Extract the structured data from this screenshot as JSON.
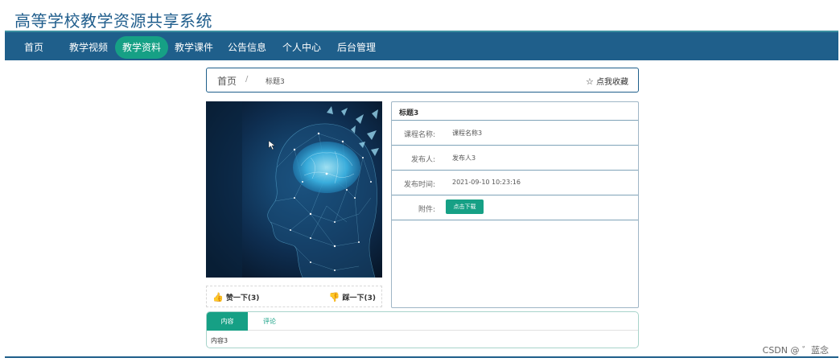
{
  "site": {
    "title": "高等学校教学资源共享系统"
  },
  "nav": {
    "items": [
      "首页",
      "教学视频",
      "教学资料",
      "教学课件",
      "公告信息",
      "个人中心",
      "后台管理"
    ],
    "active": "教学资料"
  },
  "breadcrumb": {
    "home": "首页",
    "sep": "/",
    "current": "标题3"
  },
  "favorite": {
    "label": "点我收藏"
  },
  "votes": {
    "like": "赞一下(3)",
    "dislike": "踩一下(3)"
  },
  "info": {
    "title": "标题3",
    "rows": [
      {
        "label": "课程名称:",
        "value": "课程名称3"
      },
      {
        "label": "发布人:",
        "value": "发布人3"
      },
      {
        "label": "发布时间:",
        "value": "2021-09-10 10:23:16"
      },
      {
        "label": "附件:",
        "button": "点击下载"
      }
    ]
  },
  "tabs": {
    "items": [
      "内容",
      "评论"
    ],
    "active": "内容",
    "content": "内容3"
  },
  "watermark": "CSDN @ ゛蓝念",
  "colors": {
    "nav": "#1f5f8b",
    "accent": "#16a085",
    "like": "#d9262d"
  }
}
